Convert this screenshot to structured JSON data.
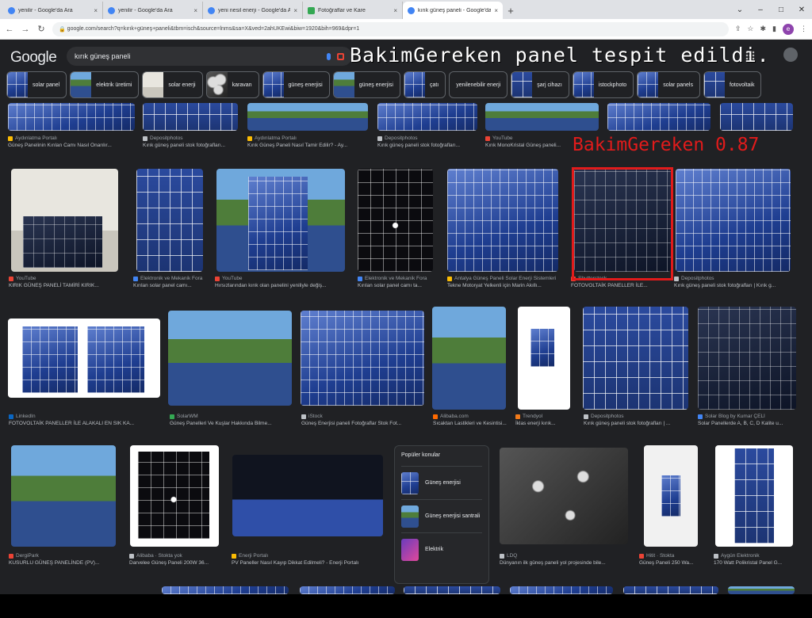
{
  "browser": {
    "tabs": [
      {
        "title": "yenilir - Google'da Ara",
        "active": false
      },
      {
        "title": "yenilir - Google'da Ara",
        "active": false
      },
      {
        "title": "yeni nesil enerji - Google'da Ara",
        "active": false
      },
      {
        "title": "Fotoğraflar ve Kare",
        "active": false
      },
      {
        "title": "kırık güneş paneli - Google'da Ara",
        "active": true
      }
    ],
    "url": "google.com/search?q=kırık+güneş+paneli&tbm=isch&source=lnms&sa=X&ved=2ahUKEwi&biw=1920&bih=969&dpr=1"
  },
  "google": {
    "logo": "Google",
    "query": "kırık güneş paneli",
    "chips": [
      "solar panel",
      "elektrik üretimi",
      "solar enerji",
      "karavan",
      "güneş enerjisi",
      "güneş enerjisi",
      "çatı",
      "yenilenebilir enerji",
      "şarj cihazı",
      "istockphoto",
      "solar panels",
      "fotovoltaik"
    ],
    "rows": [
      [
        {
          "source": "Aydınlatma Portalı",
          "title": "Güneş Panelinin Kırılan Camı Nasıl Onarılır..."
        },
        {
          "source": "Depositphotos",
          "title": "Kırık güneş paneli stok fotoğrafları..."
        },
        {
          "source": "Aydınlatma Portalı",
          "title": "Kırık Güneş Paneli Nasıl Tamir Edilir? - Ay..."
        },
        {
          "source": "Depositphotos",
          "title": "Kırık güneş paneli stok fotoğrafları..."
        },
        {
          "source": "YouTube",
          "title": "Kırık MonoKristal Güneş paneli..."
        },
        {
          "source": "Depositphotos",
          "title": "Kırık güneş paneli..."
        }
      ],
      [
        {
          "source": "YouTube",
          "title": "KIRIK GÜNEŞ PANELİ TAMİRİ KIRIK..."
        },
        {
          "source": "Elektronik ve Mekanik Fora",
          "title": "Kırılan solar panel camı..."
        },
        {
          "source": "YouTube",
          "title": "Hırsızlarından kırık olan panelini yeniliyle değiş..."
        },
        {
          "source": "Elektronik ve Mekanik Fora",
          "title": "Kırılan solar panel camı ta..."
        },
        {
          "source": "Antalya Güneş Paneli Solar Enerji Sistemleri",
          "title": "Tekne Motoryat Yelkenli için Marin Akıllı..."
        },
        {
          "source": "Shutterstock",
          "title": "FOTOVOLTAİK PANELLER İLE..."
        },
        {
          "source": "Depositphotos",
          "title": "Kırık güneş paneli stok fotoğrafları | Kırık g..."
        }
      ],
      [
        {
          "source": "LinkedIn",
          "title": "FOTOVOLTAİK PANELLER İLE ALAKALI EN SIK KA..."
        },
        {
          "source": "SolarWM",
          "title": "Güneş Panelleri Ve Kuşlar Hakkında Bilme..."
        },
        {
          "source": "iStock",
          "title": "Güneş Enerjisi paneli Fotoğraflar Stok Fot..."
        },
        {
          "source": "Alibaba.com",
          "title": "Sıcaktan Lastikleri ve Kesintisi..."
        },
        {
          "source": "Trendyol",
          "title": "İklas enerji kırık..."
        },
        {
          "source": "Depositphotos",
          "title": "Kırık güneş paneli stok fotoğrafları | ..."
        },
        {
          "source": "Solar Blog by Kumar ÇELİ",
          "title": "Solar Panellerde A, B, C, D Kalite u..."
        }
      ],
      [
        {
          "source": "DergiPark",
          "title": "KUSURLU GÜNEŞ PANELİNDE (PV)..."
        },
        {
          "source": "Alibaba · Stokta yok",
          "title": "Darvelee Güneş Paneli 200W 36..."
        },
        {
          "source": "Enerji Portalı",
          "title": "PV Paneller Nasıl Kayıp Dikkat Edilmeli? - Enerji Portalı"
        },
        {
          "source": "LDQ",
          "title": "Dünyanın ilk güneş paneli yol projesinde bile..."
        },
        {
          "source": "Hitit · Stokta",
          "title": "Güneş Paneli 250 Wa..."
        },
        {
          "source": "Aygün Elektronik",
          "title": "170 Watt Polikristal Panel G..."
        }
      ]
    ],
    "popular": {
      "heading": "Popüler konular",
      "items": [
        "Güneş enerjisi",
        "Güneş enerjisi santrali",
        "Elektrik"
      ]
    }
  },
  "overlay": {
    "banner": "BakimGereken panel tespit edildi.",
    "detection_label": "BakimGereken 0.87",
    "detection_color": "#e11b1b"
  }
}
